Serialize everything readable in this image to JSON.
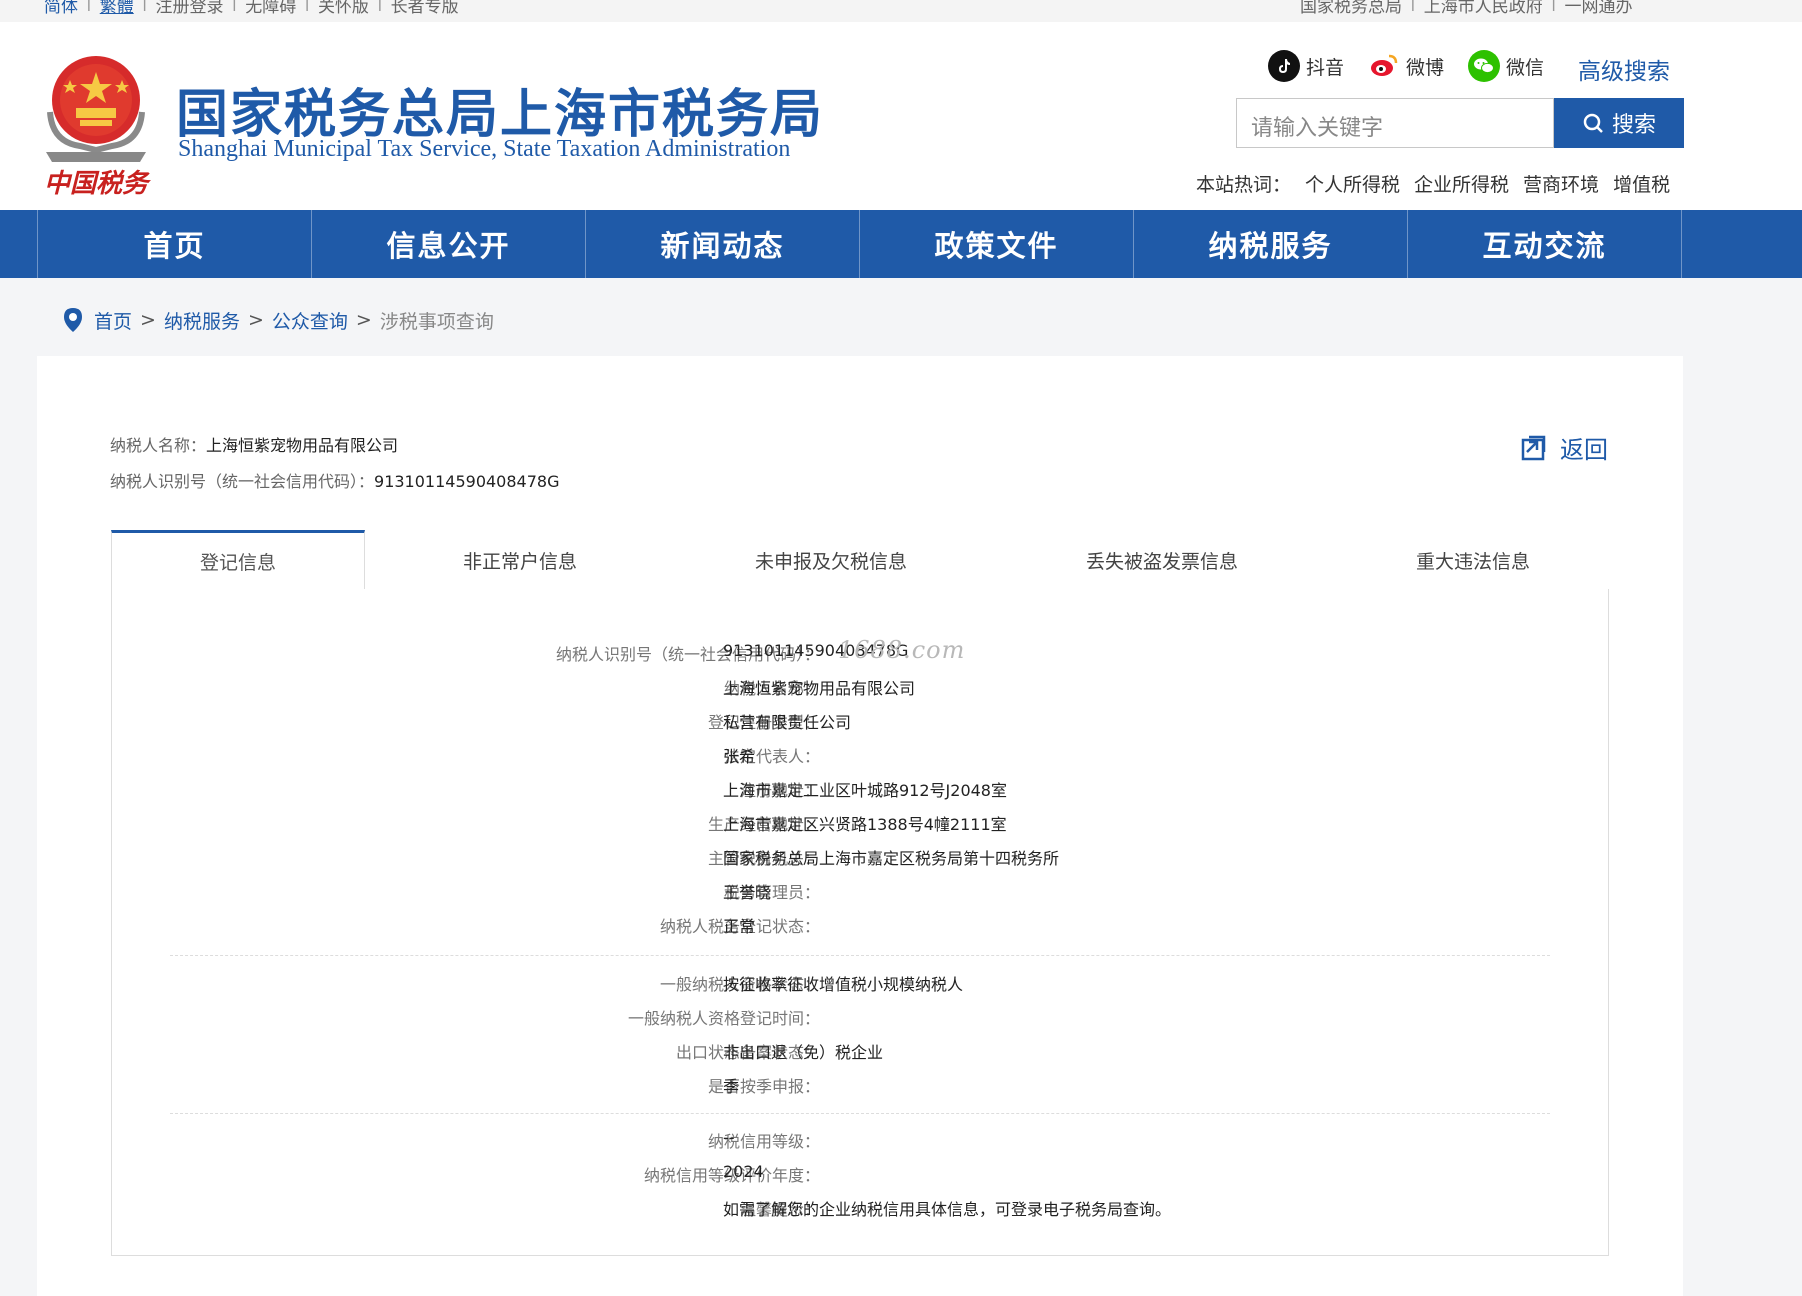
{
  "topbar": {
    "left": [
      "简体",
      "繁體",
      "注册登录",
      "无障碍",
      "关怀版",
      "长者专版"
    ],
    "right": [
      "国家税务总局",
      "上海市人民政府",
      "一网通办"
    ]
  },
  "header": {
    "title": "国家税务总局上海市税务局",
    "subtitle": "Shanghai Municipal Tax Service, State Taxation Administration",
    "emblem_text": "中国税务",
    "social": [
      {
        "label": "抖音",
        "icon": "douyin-icon"
      },
      {
        "label": "微博",
        "icon": "weibo-icon"
      },
      {
        "label": "微信",
        "icon": "wechat-icon"
      }
    ],
    "advanced_search": "高级搜索",
    "search_placeholder": "请输入关键字",
    "search_button": "搜索",
    "hot_label": "本站热词：",
    "hot_words": [
      "个人所得税",
      "企业所得税",
      "营商环境",
      "增值税"
    ]
  },
  "nav": [
    "首页",
    "信息公开",
    "新闻动态",
    "政策文件",
    "纳税服务",
    "互动交流"
  ],
  "breadcrumb": {
    "items": [
      "首页",
      "纳税服务",
      "公众查询"
    ],
    "current": "涉税事项查询",
    "sep": ">"
  },
  "taxpayer": {
    "name_label": "纳税人名称：",
    "name": "上海恒紫宠物用品有限公司",
    "id_label": "纳税人识别号（统一社会信用代码）：",
    "id": "91310114590408478G"
  },
  "back_label": "返回",
  "tabs": [
    "登记信息",
    "非正常户信息",
    "未申报及欠税信息",
    "丢失被盗发票信息",
    "重大违法信息"
  ],
  "watermark": "1688.com",
  "groups": [
    [
      {
        "label": "纳税人识别号（统一社会信用代码）：",
        "value": "91310114590408478G"
      },
      {
        "label": "纳税人名称：",
        "value": "上海恒紫宠物用品有限公司"
      },
      {
        "label": "登记注册类型：",
        "value": "私营有限责任公司"
      },
      {
        "label": "法定代表人：",
        "value": "张希"
      },
      {
        "label": "注册地址：",
        "value": "上海市嘉定工业区叶城路912号J2048室"
      },
      {
        "label": "生产经营地址：",
        "value": "上海市嘉定区兴贤路1388号4幢2111室"
      },
      {
        "label": "主管税务机关：",
        "value": "国家税务总局上海市嘉定区税务局第十四税务所"
      },
      {
        "label": "税务管理员：",
        "value": "王誉晓"
      },
      {
        "label": "纳税人税务登记状态：",
        "value": "正常"
      }
    ],
    [
      {
        "label": "一般纳税人资格状态：",
        "value": "按征收率征收增值税小规模纳税人"
      },
      {
        "label": "一般纳税人资格登记时间：",
        "value": ""
      },
      {
        "label": "出口状态备案状态：",
        "value": "非出口退（免）税企业"
      },
      {
        "label": "是否按季申报：",
        "value": "季"
      }
    ],
    [
      {
        "label": "纳税信用等级：",
        "value": "--"
      },
      {
        "label": "纳税信用等级评价年度：",
        "value": "2024"
      },
      {
        "label": "温馨提示：",
        "value": "如需了解您的企业纳税信用具体信息，可登录电子税务局查询。"
      }
    ]
  ]
}
